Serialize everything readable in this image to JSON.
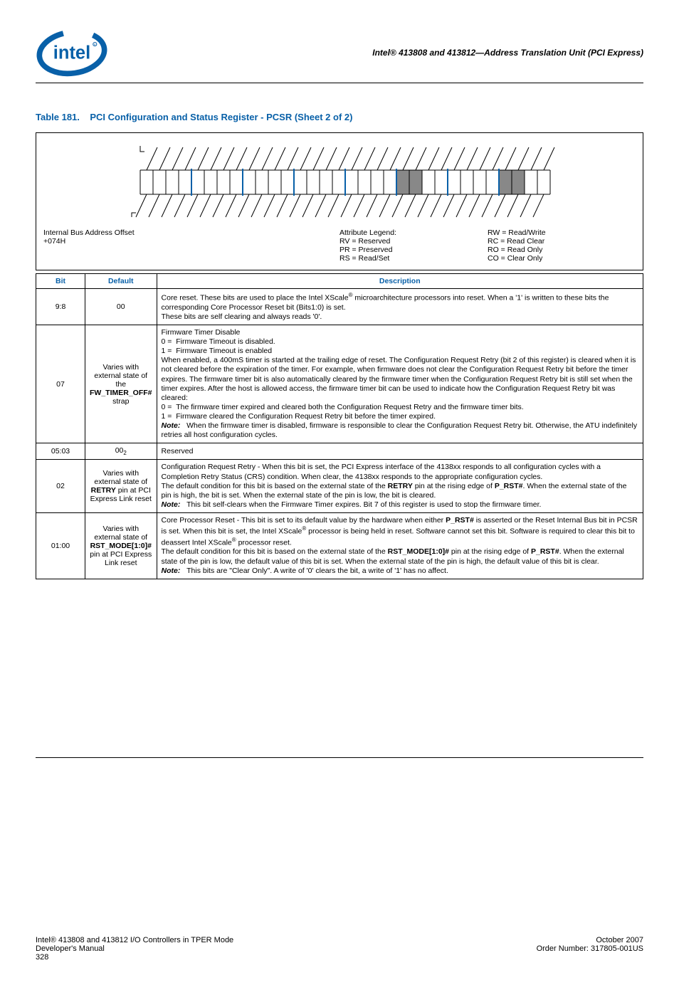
{
  "header": {
    "doc_title": "Intel® 413808 and 413812—Address Translation Unit (PCI Express)"
  },
  "table": {
    "caption_num": "Table 181.",
    "caption_text": "PCI Configuration and Status Register - PCSR (Sheet 2 of 2)",
    "offset_label": "Internal Bus Address Offset",
    "offset_value": "+074H",
    "legend_title": "Attribute Legend:",
    "legend": {
      "rv": "RV = Reserved",
      "pr": "PR = Preserved",
      "rs": "RS = Read/Set",
      "rw": "RW = Read/Write",
      "rc": "RC = Read Clear",
      "ro": "RO = Read Only",
      "co": "CO = Clear Only"
    },
    "headers": {
      "bit": "Bit",
      "def": "Default",
      "desc": "Description"
    },
    "rows": [
      {
        "bit": "9:8",
        "def_html": "00",
        "desc_html": "Core reset. These bits are used to place the Intel XScale<sup>®</sup> microarchitecture processors into reset. When a '1' is written to these bits the corresponding Core Processor Reset bit (Bits1:0) is set.<br>These bits are self clearing and always reads '0'."
      },
      {
        "bit": "07",
        "def_html": "Varies with external state of the <b>FW_TIMER_OFF#</b> strap",
        "desc_html": "Firmware Timer Disable<br>0 =&nbsp;&nbsp;Firmware Timeout is disabled.<br>1 =&nbsp;&nbsp;Firmware Timeout is enabled<br>When enabled, a 400mS timer is started at the trailing edge of reset. The Configuration Request Retry (bit 2 of this register) is cleared when it is not cleared before the expiration of the timer. For example, when firmware does not clear the Configuration Request Retry bit before the timer expires. The firmware timer bit is also automatically cleared by the firmware timer when the Configuration Request Retry bit is still set when the timer expires. After the host is allowed access, the firmware timer bit can be used to indicate how the Configuration Request Retry bit was cleared:<br>0 =&nbsp;&nbsp;The firmware timer expired and cleared both the Configuration Request Retry and the firmware timer bits.<br>1 =&nbsp;&nbsp;Firmware cleared the Configuration Request Retry bit before the timer expired.<br><span class='note-lbl'>Note:</span>&nbsp;&nbsp;&nbsp;When the firmware timer is disabled, firmware is responsible to clear the Configuration Request Retry bit. Otherwise, the ATU indefinitely retries all host configuration cycles."
      },
      {
        "bit": "05:03",
        "def_html": "00<sub>2</sub>",
        "desc_html": "Reserved"
      },
      {
        "bit": "02",
        "def_html": "Varies with external state of <b>RETRY</b> pin at PCI Express Link reset",
        "desc_html": "Configuration Request Retry - When this bit is set, the PCI Express interface of the 4138xx responds to all configuration cycles with a Completion Retry Status (CRS) condition. When clear, the 4138xx responds to the appropriate configuration cycles.<br>The default condition for this bit is based on the external state of the <b>RETRY</b> pin at the rising edge of <b>P_RST#</b>. When the external state of the pin is high, the bit is set. When the external state of the pin is low, the bit is cleared.<br><span class='note-lbl'>Note:</span>&nbsp;&nbsp;&nbsp;This bit self-clears when the Firmware Timer expires. Bit 7 of this register is used to stop the firmware timer."
      },
      {
        "bit": "01:00",
        "def_html": "Varies with external state of <b>RST_MODE[1:0]#</b> pin at PCI Express Link reset",
        "desc_html": "Core Processor Reset - This bit is set to its default value by the hardware when either <b>P_RST#</b> is asserted or the Reset Internal Bus bit in PCSR is set. When this bit is set, the Intel XScale<sup>®</sup> processor is being held in reset. Software cannot set this bit. Software is required to clear this bit to deassert Intel XScale<sup>®</sup> processor reset.<br>The default condition for this bit is based on the external state of the <b>RST_MODE[1:0]#</b> pin at the rising edge of <b>P_RST#</b>. When the external state of the pin is low, the default value of this bit is set. When the external state of the pin is high, the default value of this bit is clear.<br><span class='note-lbl'>Note:</span>&nbsp;&nbsp;&nbsp;This bits are \"Clear Only\". A write of '0' clears the bit, a write of '1' has no affect."
      }
    ]
  },
  "footer": {
    "left1": "Intel® 413808 and 413812 I/O Controllers in TPER Mode",
    "left2": "Developer's Manual",
    "left3": "328",
    "right1": "October 2007",
    "right2": "Order Number: 317805-001US"
  }
}
